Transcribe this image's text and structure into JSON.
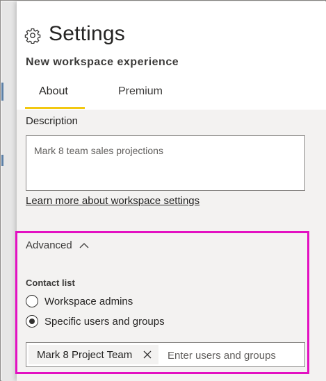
{
  "header": {
    "title": "Settings",
    "subtitle": "New workspace experience",
    "icon": "gear-icon"
  },
  "tabs": [
    {
      "label": "About",
      "selected": true
    },
    {
      "label": "Premium",
      "selected": false
    }
  ],
  "description": {
    "label": "Description",
    "value": "Mark 8 team sales projections"
  },
  "learn_more_link": "Learn more about workspace settings",
  "advanced": {
    "label": "Advanced",
    "expanded": true,
    "contact_list": {
      "label": "Contact list",
      "options": [
        {
          "label": "Workspace admins",
          "selected": false
        },
        {
          "label": "Specific users and groups",
          "selected": true
        }
      ]
    },
    "people_picker": {
      "chip_label": "Mark 8 Project Team",
      "placeholder": "Enter users and groups"
    }
  },
  "colors": {
    "tab_underline": "#f2c811",
    "highlight_border": "#e311c2",
    "panel_background": "#f3f2f1"
  }
}
